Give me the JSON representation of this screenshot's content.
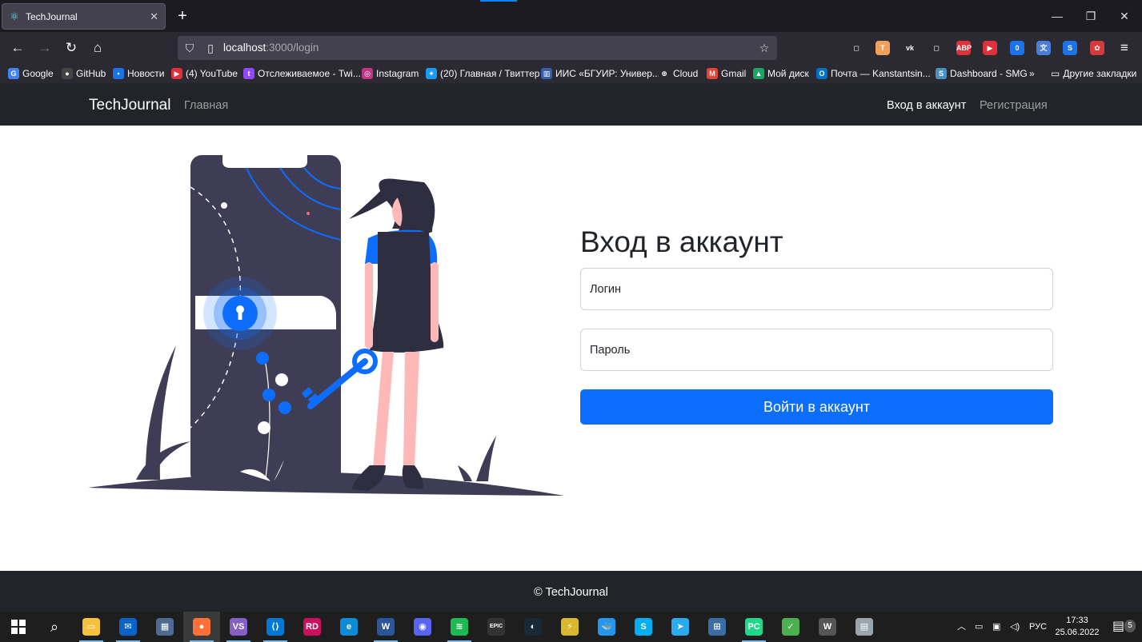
{
  "browser": {
    "tab_title": "TechJournal",
    "url_host": "localhost",
    "url_rest": ":3000/login",
    "extensions": [
      {
        "name": "pocket-icon",
        "color": "#2b2a33",
        "text": ""
      },
      {
        "name": "extension-t-icon",
        "color": "#f0a05a",
        "text": "T"
      },
      {
        "name": "vk-icon",
        "color": "#2b2a33",
        "text": "vk"
      },
      {
        "name": "reader-icon",
        "color": "#2b2a33",
        "text": ""
      },
      {
        "name": "adblock-icon",
        "color": "#e0313a",
        "text": "ABP"
      },
      {
        "name": "youtube-ext-icon",
        "color": "#e0313a",
        "text": "▶"
      },
      {
        "name": "badge-extension-icon",
        "color": "#1a73e8",
        "text": "0"
      },
      {
        "name": "translate-icon",
        "color": "#4a7fd6",
        "text": "文"
      },
      {
        "name": "s-extension-icon",
        "color": "#1a73e8",
        "text": "S"
      },
      {
        "name": "gift-extension-icon",
        "color": "#d63b3b",
        "text": "✿"
      }
    ],
    "bookmarks": [
      {
        "label": "Google",
        "icon": "google-icon",
        "color": "#4285f4",
        "glyph": "G"
      },
      {
        "label": "GitHub",
        "icon": "github-icon",
        "color": "#444",
        "glyph": "●"
      },
      {
        "label": "Новости",
        "icon": "news-icon",
        "color": "#1a73e8",
        "glyph": "▪"
      },
      {
        "label": "(4) YouTube",
        "icon": "youtube-icon",
        "color": "#e0313a",
        "glyph": "▶"
      },
      {
        "label": "Отслеживаемое - Twi...",
        "icon": "twitch-icon",
        "color": "#9146ff",
        "glyph": "t"
      },
      {
        "label": "Instagram",
        "icon": "instagram-icon",
        "color": "#c13584",
        "glyph": "◎"
      },
      {
        "label": "(20) Главная / Твиттер",
        "icon": "twitter-icon",
        "color": "#1d9bf0",
        "glyph": "✦"
      },
      {
        "label": "ИИС «БГУИР: Универ...",
        "icon": "bsuir-icon",
        "color": "#3b5ea8",
        "glyph": "▥"
      },
      {
        "label": "Cloud",
        "icon": "globe-icon",
        "color": "#2b2a33",
        "glyph": "⊕"
      },
      {
        "label": "Gmail",
        "icon": "gmail-icon",
        "color": "#ea4335",
        "glyph": "M"
      },
      {
        "label": "Мой диск",
        "icon": "google-drive-icon",
        "color": "#1fa463",
        "glyph": "▲"
      },
      {
        "label": "Почта — Kanstantsin...",
        "icon": "outlook-icon",
        "color": "#0072c6",
        "glyph": "O"
      },
      {
        "label": "Dashboard - SMG",
        "icon": "smg-icon",
        "color": "#4a90c0",
        "glyph": "S"
      }
    ],
    "other_bookmarks": "Другие закладки"
  },
  "site": {
    "brand": "TechJournal",
    "nav_home": "Главная",
    "nav_login": "Вход в аккаунт",
    "nav_register": "Регистрация",
    "login_title": "Вход в аккаунт",
    "login_placeholder": "Логин",
    "password_placeholder": "Пароль",
    "submit_label": "Войти в аккаунт",
    "footer": "© TechJournal"
  },
  "taskbar": {
    "apps": [
      {
        "name": "explorer-icon",
        "color": "#f6c23e",
        "text": "▭",
        "active": false
      },
      {
        "name": "mail-icon",
        "color": "#0a64c8",
        "text": "✉",
        "active": false
      },
      {
        "name": "calculator-icon",
        "color": "#4c6a92",
        "text": "▦",
        "active": false
      },
      {
        "name": "firefox-icon",
        "color": "#ff7139",
        "text": "●",
        "active": true
      },
      {
        "name": "visual-studio-icon",
        "color": "#865fc5",
        "text": "VS",
        "active": false
      },
      {
        "name": "vscode-icon",
        "color": "#0078d4",
        "text": "⟨⟩",
        "active": false
      },
      {
        "name": "rider-icon",
        "color": "#c90f5e",
        "text": "RD",
        "active": false
      },
      {
        "name": "edge-icon",
        "color": "#0c8bd6",
        "text": "e",
        "active": false
      },
      {
        "name": "word-icon",
        "color": "#2b579a",
        "text": "W",
        "active": false
      },
      {
        "name": "discord-icon",
        "color": "#5865f2",
        "text": "◉",
        "active": false
      },
      {
        "name": "spotify-icon",
        "color": "#1db954",
        "text": "≋",
        "active": false
      },
      {
        "name": "epic-games-icon",
        "color": "#333",
        "text": "EPIC",
        "active": false
      },
      {
        "name": "steam-icon",
        "color": "#1b2838",
        "text": "◐",
        "active": false
      },
      {
        "name": "vpn-icon",
        "color": "#d9b92b",
        "text": "⚡",
        "active": false
      },
      {
        "name": "docker-icon",
        "color": "#2496ed",
        "text": "🐳",
        "active": false
      },
      {
        "name": "skype-icon",
        "color": "#00aff0",
        "text": "S",
        "active": false
      },
      {
        "name": "telegram-icon",
        "color": "#2aabee",
        "text": "➤",
        "active": false
      },
      {
        "name": "sql-server-icon",
        "color": "#3a6ea5",
        "text": "⊞",
        "active": false
      },
      {
        "name": "pycharm-icon",
        "color": "#21d789",
        "text": "PC",
        "active": false
      },
      {
        "name": "ticktick-icon",
        "color": "#4caf50",
        "text": "✓",
        "active": false
      },
      {
        "name": "wordpress-icon",
        "color": "#555",
        "text": "W",
        "active": false
      },
      {
        "name": "database-icon",
        "color": "#9aa4ad",
        "text": "▤",
        "active": false
      }
    ],
    "language": "РУС",
    "time": "17:33",
    "date": "25.06.2022",
    "notifications": "5"
  }
}
